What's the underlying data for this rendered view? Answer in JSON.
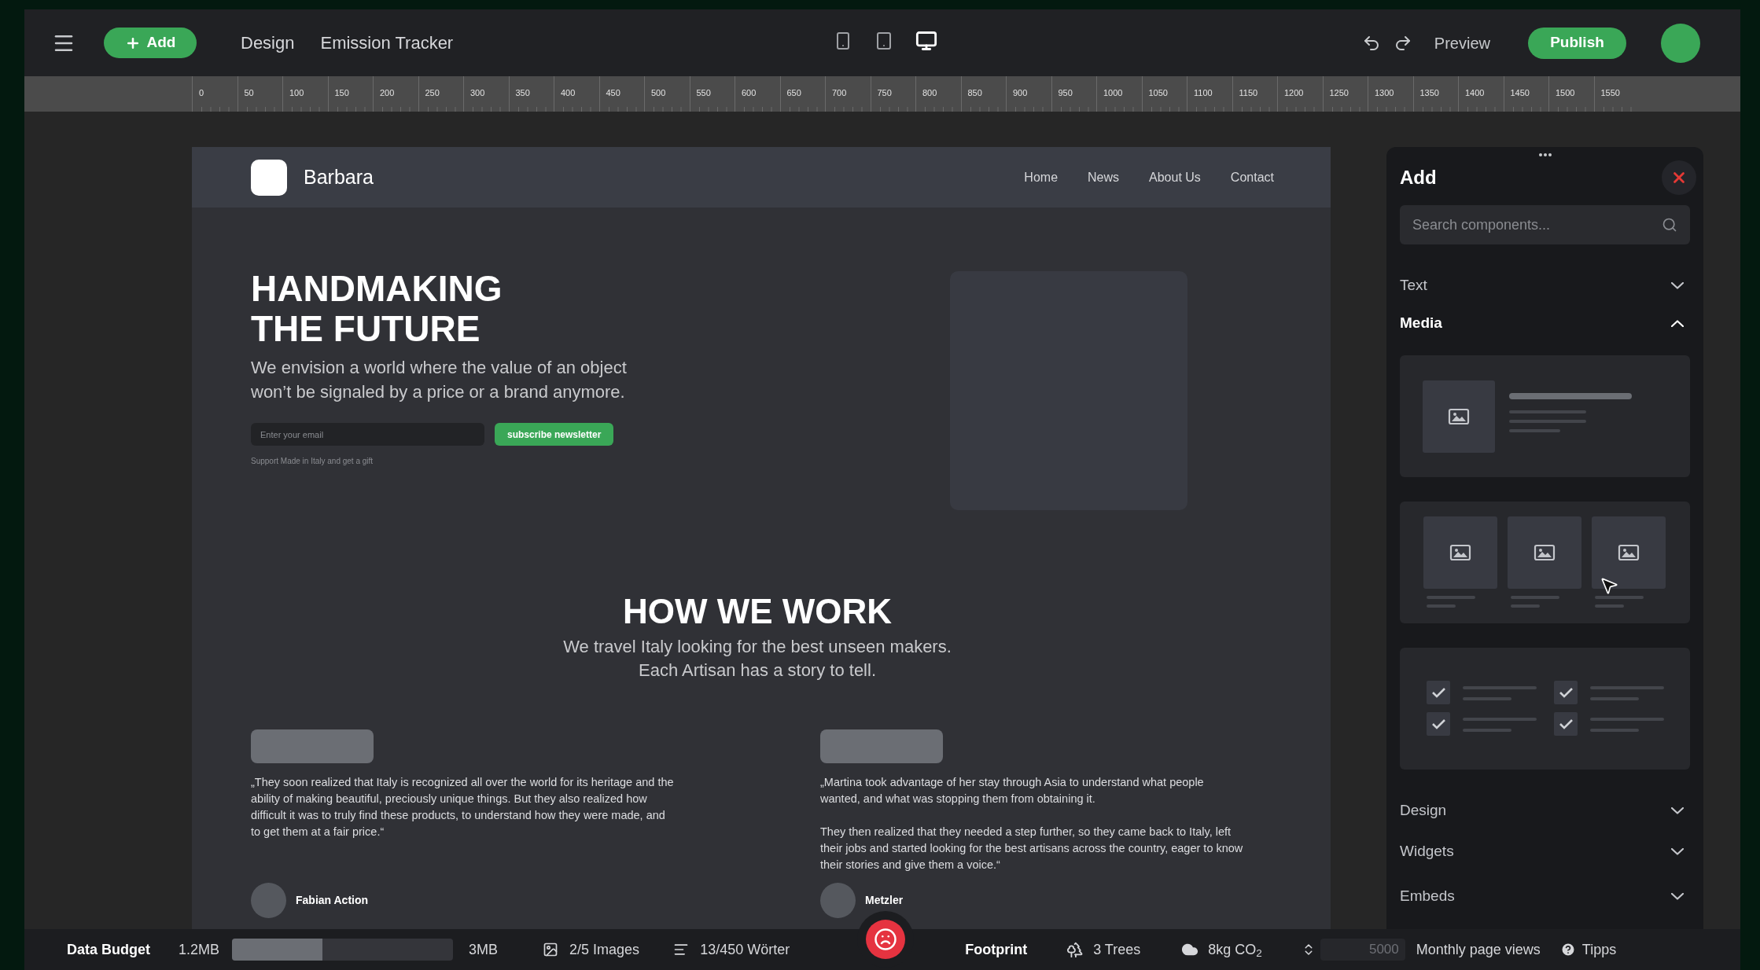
{
  "toolbar": {
    "add_button": "Add",
    "mode": "Design",
    "project_title": "Emission Tracker",
    "devices": [
      {
        "kind": "phone",
        "selected": false
      },
      {
        "kind": "tablet",
        "selected": false
      },
      {
        "kind": "desktop",
        "selected": true
      }
    ],
    "preview": "Preview",
    "publish": "Publish"
  },
  "ruler": {
    "labels": [
      "0",
      "50",
      "100",
      "150",
      "200",
      "250",
      "300",
      "350",
      "400",
      "450",
      "500",
      "550",
      "600",
      "650",
      "700",
      "750",
      "800",
      "850",
      "900",
      "950",
      "1000",
      "1050",
      "1100",
      "1150",
      "1200",
      "1250",
      "1300",
      "1350",
      "1400",
      "1450",
      "1500",
      "1550"
    ]
  },
  "page": {
    "brand": "Barbara",
    "nav": [
      "Home",
      "News",
      "About Us",
      "Contact"
    ],
    "hero": {
      "title_lines": [
        "HANDMAKING",
        "THE FUTURE"
      ],
      "subtitle_lines": [
        "We envision a world where the value of an object",
        "won’t be signaled by a price or a brand anymore."
      ],
      "email_placeholder": "Enter your email",
      "subscribe_button": "subscribe newsletter",
      "note": "Support Made in Italy and get a gift"
    },
    "section": {
      "title": "HOW WE WORK",
      "subtitle_lines": [
        "We travel Italy looking for the best unseen makers.",
        "Each Artisan has a story to tell."
      ]
    },
    "testimonials": [
      {
        "paragraphs": [
          "„They soon realized that Italy is recognized all over the world for its heritage and the ability of making beautiful, preciously unique things. But they also realized how difficult it was to truly find these products, to understand how they were made, and to get them at a fair price.“"
        ],
        "name": "Fabian Action"
      },
      {
        "paragraphs": [
          "„Martina took advantage of her stay through Asia to understand what people wanted, and what was stopping them from obtaining it.",
          "They then realized that they needed a step further, so they came back to Italy, left their jobs and started looking for the best artisans across the country, eager to know their stories and give them a voice.“"
        ],
        "name": "Metzler"
      }
    ]
  },
  "add_panel": {
    "title": "Add",
    "search_placeholder": "Search components...",
    "categories": [
      {
        "label": "Text",
        "expanded": false
      },
      {
        "label": "Media",
        "expanded": true,
        "items": [
          {
            "kind": "image-text"
          },
          {
            "kind": "image-grid"
          },
          {
            "kind": "checklist"
          }
        ]
      },
      {
        "label": "Design",
        "expanded": false
      },
      {
        "label": "Widgets",
        "expanded": false
      },
      {
        "label": "Embeds",
        "expanded": false
      }
    ]
  },
  "status_bar": {
    "budget_label": "Data Budget",
    "used": "1.2MB",
    "level": 0.41,
    "limit": "3MB",
    "images": "2/5 Images",
    "words": "13/450 Wörter",
    "footprint_label": "Footprint",
    "trees": "3 Trees",
    "co2": "8kg CO$_{2}$",
    "page_views": "5000",
    "page_views_label": "Monthly page views",
    "tips": "Tipps"
  }
}
